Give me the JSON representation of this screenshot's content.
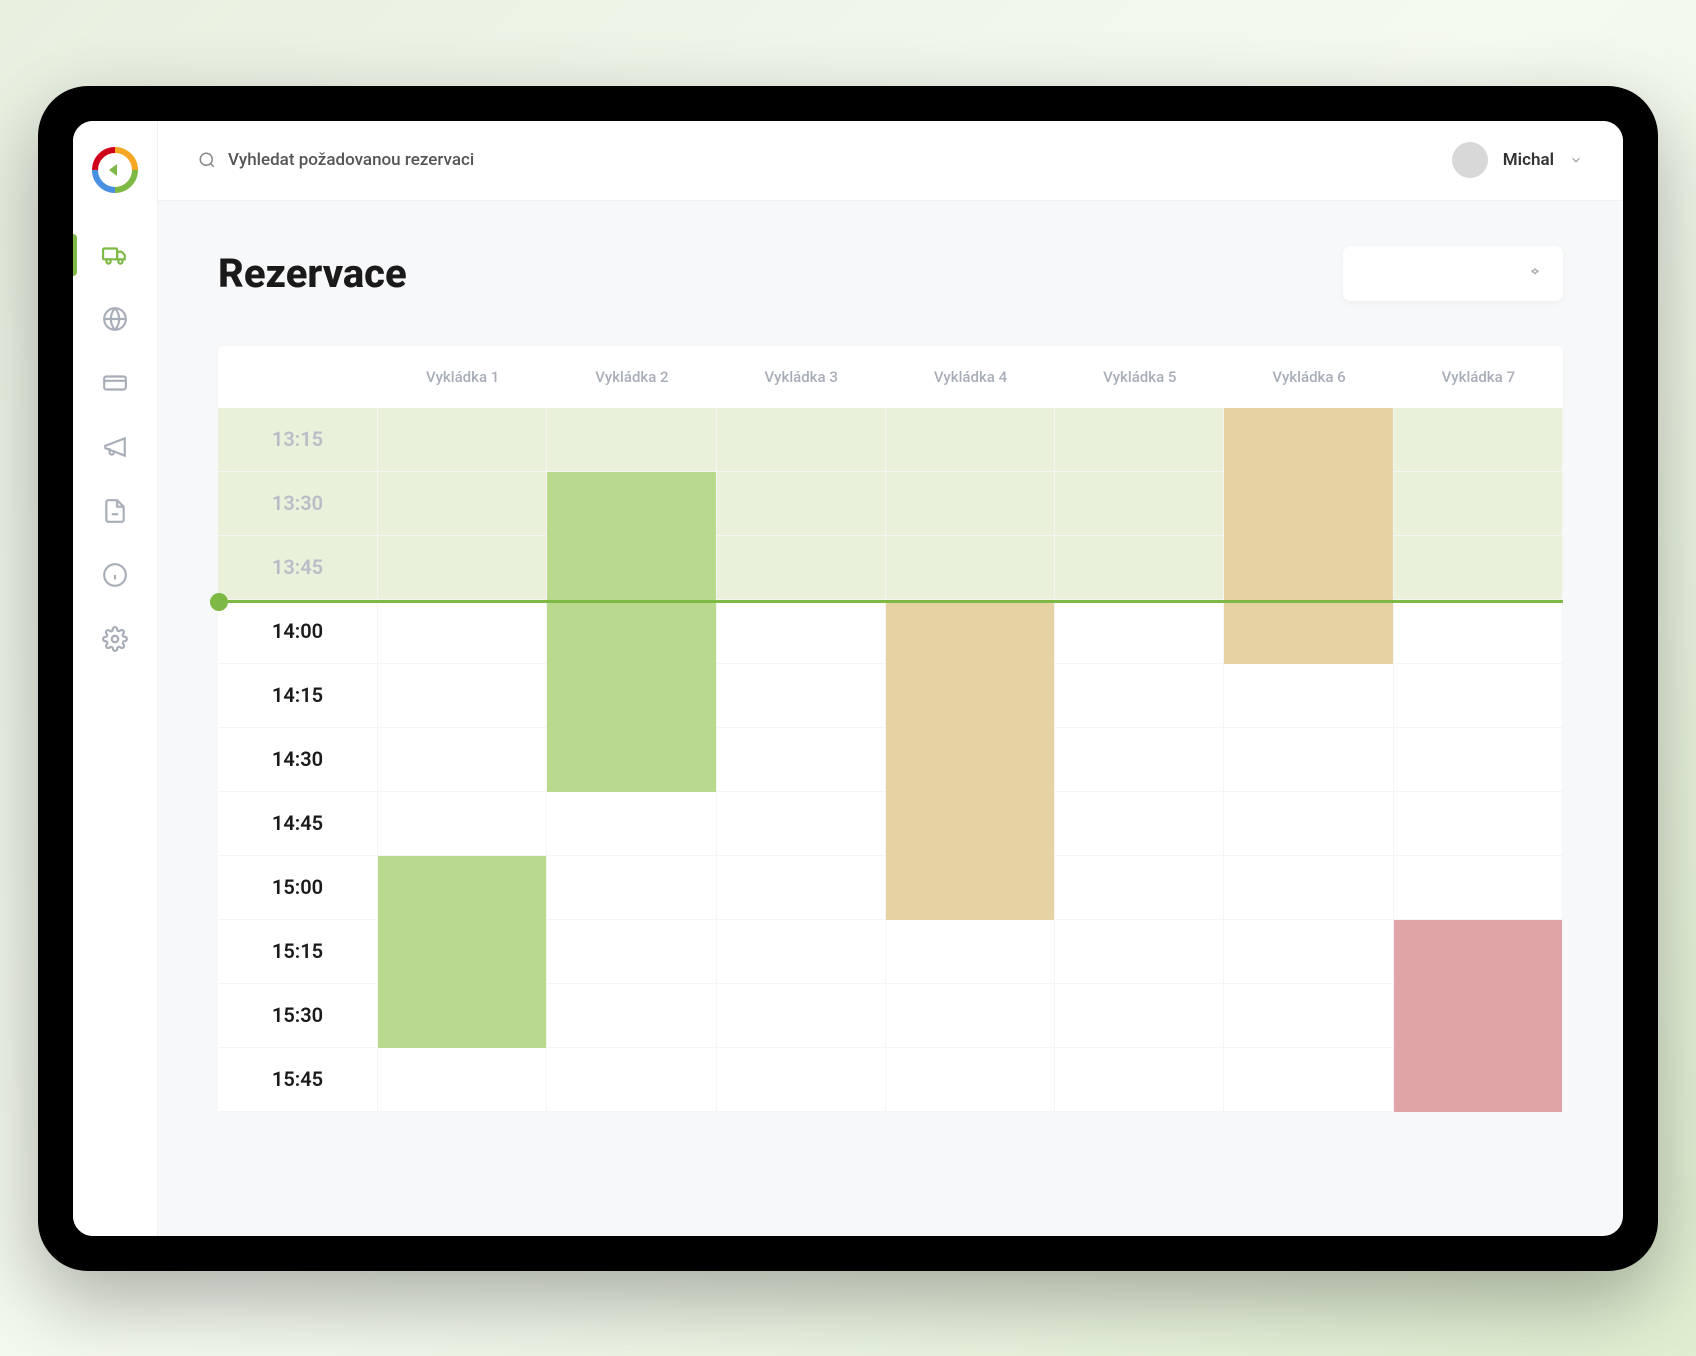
{
  "search": {
    "placeholder": "Vyhledat požadovanou rezervaci"
  },
  "user": {
    "name": "Michal"
  },
  "page": {
    "title": "Rezervace"
  },
  "schedule": {
    "columns": [
      "Vykládka 1",
      "Vykládka 2",
      "Vykládka 3",
      "Vykládka 4",
      "Vykládka 5",
      "Vykládka 6",
      "Vykládka 7"
    ],
    "times": [
      "13:15",
      "13:30",
      "13:45",
      "14:00",
      "14:15",
      "14:30",
      "14:45",
      "15:00",
      "15:15",
      "15:30",
      "15:45"
    ],
    "currentTimeRow": 3,
    "bookings": [
      {
        "column": 0,
        "startRow": 7,
        "span": 3,
        "color": "green"
      },
      {
        "column": 1,
        "startRow": 1,
        "span": 5,
        "color": "green"
      },
      {
        "column": 3,
        "startRow": 3,
        "span": 5,
        "color": "yellow"
      },
      {
        "column": 5,
        "startRow": 0,
        "span": 4,
        "color": "yellow"
      },
      {
        "column": 6,
        "startRow": 8,
        "span": 3,
        "color": "red"
      }
    ]
  }
}
